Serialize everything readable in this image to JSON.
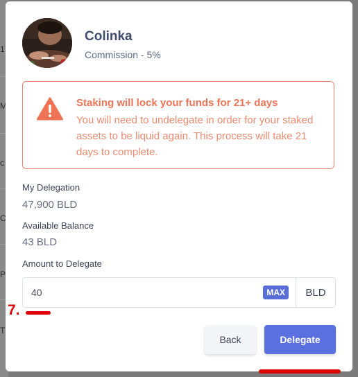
{
  "background": {
    "row_fragments": [
      "1",
      "M",
      "c",
      "C",
      "P",
      "T"
    ]
  },
  "validator": {
    "name": "Colinka",
    "commission": "Commission - 5%"
  },
  "warning": {
    "icon": "warning-triangle-icon",
    "title": "Staking will lock your funds for 21+ days",
    "body": "You will need to undelegate in order for your staked assets to be liquid again. This process will take 21 days to complete."
  },
  "delegation": {
    "label": "My Delegation",
    "value": "47,900 BLD"
  },
  "balance": {
    "label": "Available Balance",
    "value": "43 BLD"
  },
  "amount": {
    "label": "Amount to Delegate",
    "value": "40",
    "max_label": "MAX",
    "unit": "BLD"
  },
  "actions": {
    "back_label": "Back",
    "delegate_label": "Delegate"
  },
  "annotation": {
    "step_label": "7."
  },
  "colors": {
    "accent": "#5a70e0",
    "warning": "#ef7455",
    "annotation": "#e00000"
  }
}
